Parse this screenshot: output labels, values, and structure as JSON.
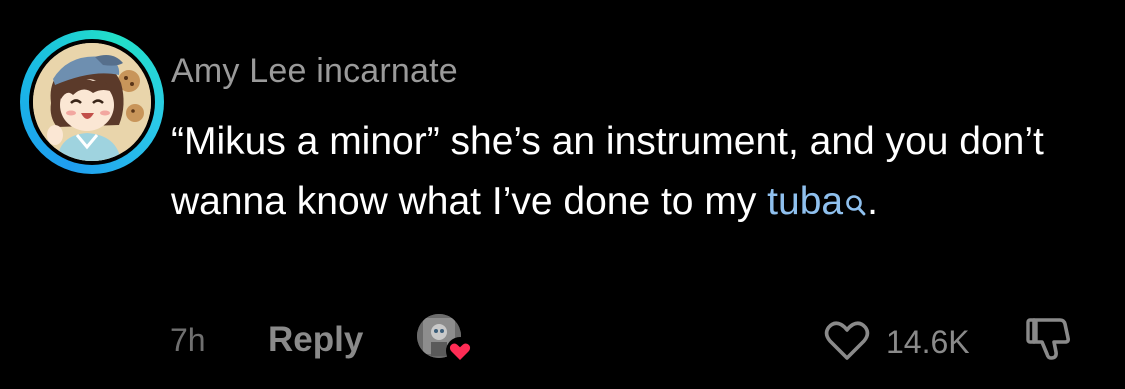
{
  "comment": {
    "username": "Amy Lee incarnate",
    "text_before_link": "“Mikus a minor” she’s an instrument, and you don’t wanna know what I’ve done to my ",
    "link_text": "tuba",
    "text_after_link": ".",
    "link_icon": "search-icon",
    "avatar_ring_colors": [
      "#1f9df0",
      "#22e0c8"
    ],
    "link_color": "#8fc0ee"
  },
  "footer": {
    "time": "7h",
    "reply_label": "Reply",
    "creator_liked_icon": "heart-icon",
    "like_icon": "heart-outline-icon",
    "like_count": "14.6K",
    "dislike_icon": "thumbs-down-icon"
  }
}
